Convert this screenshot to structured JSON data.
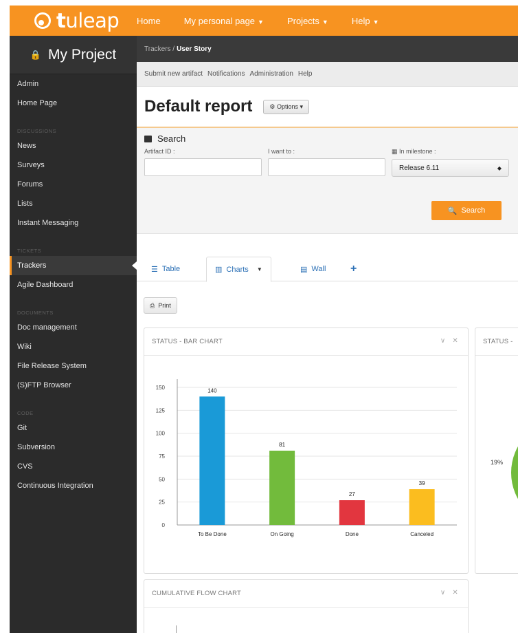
{
  "brand": {
    "name_bold": "t",
    "name_rest": "uleap"
  },
  "topnav": [
    {
      "label": "Home",
      "dropdown": false
    },
    {
      "label": "My personal page",
      "dropdown": true
    },
    {
      "label": "Projects",
      "dropdown": true
    },
    {
      "label": "Help",
      "dropdown": true
    }
  ],
  "sidebar": {
    "project": "My Project",
    "admin": "Admin",
    "home": "Home Page",
    "discussions_heading": "DISCUSSIONS",
    "news": "News",
    "surveys": "Surveys",
    "forums": "Forums",
    "lists": "Lists",
    "im": "Instant Messaging",
    "tickets_heading": "TICKETS",
    "trackers": "Trackers",
    "agile": "Agile Dashboard",
    "documents_heading": "DOCUMENTS",
    "docman": "Doc management",
    "wiki": "Wiki",
    "frs": "File Release System",
    "ftp": "(S)FTP Browser",
    "code_heading": "CODE",
    "git": "Git",
    "svn": "Subversion",
    "cvs": "CVS",
    "ci": "Continuous Integration"
  },
  "breadcrumb": {
    "parent": "Trackers /",
    "current": "User Story"
  },
  "subnav": [
    "Submit new artifact",
    "Notifications",
    "Administration",
    "Help"
  ],
  "report": {
    "title": "Default report",
    "options_label": "Options"
  },
  "search": {
    "title": "Search",
    "artifact_id_label": "Artifact ID :",
    "i_want_to_label": "I want to :",
    "milestone_label": "In milestone :",
    "milestone_value": "Release 6.11",
    "button": "Search"
  },
  "tabs": {
    "table": "Table",
    "charts": "Charts",
    "wall": "Wall",
    "add": "+"
  },
  "print_label": "Print",
  "widgets": {
    "bar_title": "STATUS - BAR CHART",
    "pie_title": "STATUS -",
    "pie_label": "19%",
    "cfd_title": "CUMULATIVE FLOW CHART"
  },
  "colors": {
    "accent": "#f79321",
    "sidebar_bg": "#2b2b2b"
  },
  "chart_data": {
    "type": "bar",
    "categories": [
      "To Be Done",
      "On Going",
      "Done",
      "Canceled"
    ],
    "values": [
      140,
      81,
      27,
      39
    ],
    "colors": [
      "#1a9ad7",
      "#72bb3c",
      "#e2363f",
      "#fbbd1f"
    ],
    "y_ticks": [
      0,
      25,
      50,
      75,
      100,
      125,
      150
    ],
    "ylim": [
      0,
      150
    ],
    "grid": true
  }
}
